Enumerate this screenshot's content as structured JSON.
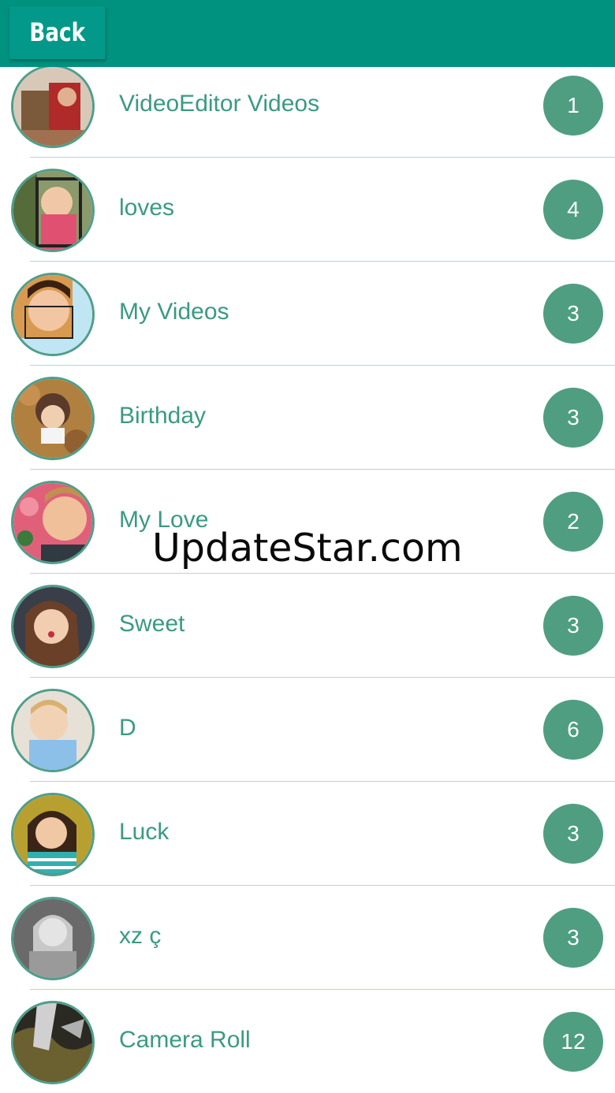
{
  "header": {
    "back_label": "Back",
    "bar_color": "#00917f"
  },
  "albums": [
    {
      "name": "VideoEditor Videos",
      "count": "1",
      "thumb": "photo-thumbnail-icon"
    },
    {
      "name": "loves",
      "count": "4",
      "thumb": "photo-thumbnail-icon"
    },
    {
      "name": "My Videos",
      "count": "3",
      "thumb": "photo-thumbnail-icon"
    },
    {
      "name": "Birthday",
      "count": "3",
      "thumb": "photo-thumbnail-icon"
    },
    {
      "name": "My Love",
      "count": "2",
      "thumb": "photo-thumbnail-icon"
    },
    {
      "name": "Sweet",
      "count": "3",
      "thumb": "photo-thumbnail-icon"
    },
    {
      "name": "D",
      "count": "6",
      "thumb": "photo-thumbnail-icon"
    },
    {
      "name": "Luck",
      "count": "3",
      "thumb": "photo-thumbnail-icon"
    },
    {
      "name": "xz ç",
      "count": "3",
      "thumb": "photo-thumbnail-icon"
    },
    {
      "name": "Camera Roll",
      "count": "12",
      "thumb": "photo-thumbnail-icon"
    }
  ],
  "watermark": "UpdateStar.com",
  "colors": {
    "accent": "#4f9e82",
    "text": "#3a9a82",
    "divider": "#b9d3dc"
  }
}
